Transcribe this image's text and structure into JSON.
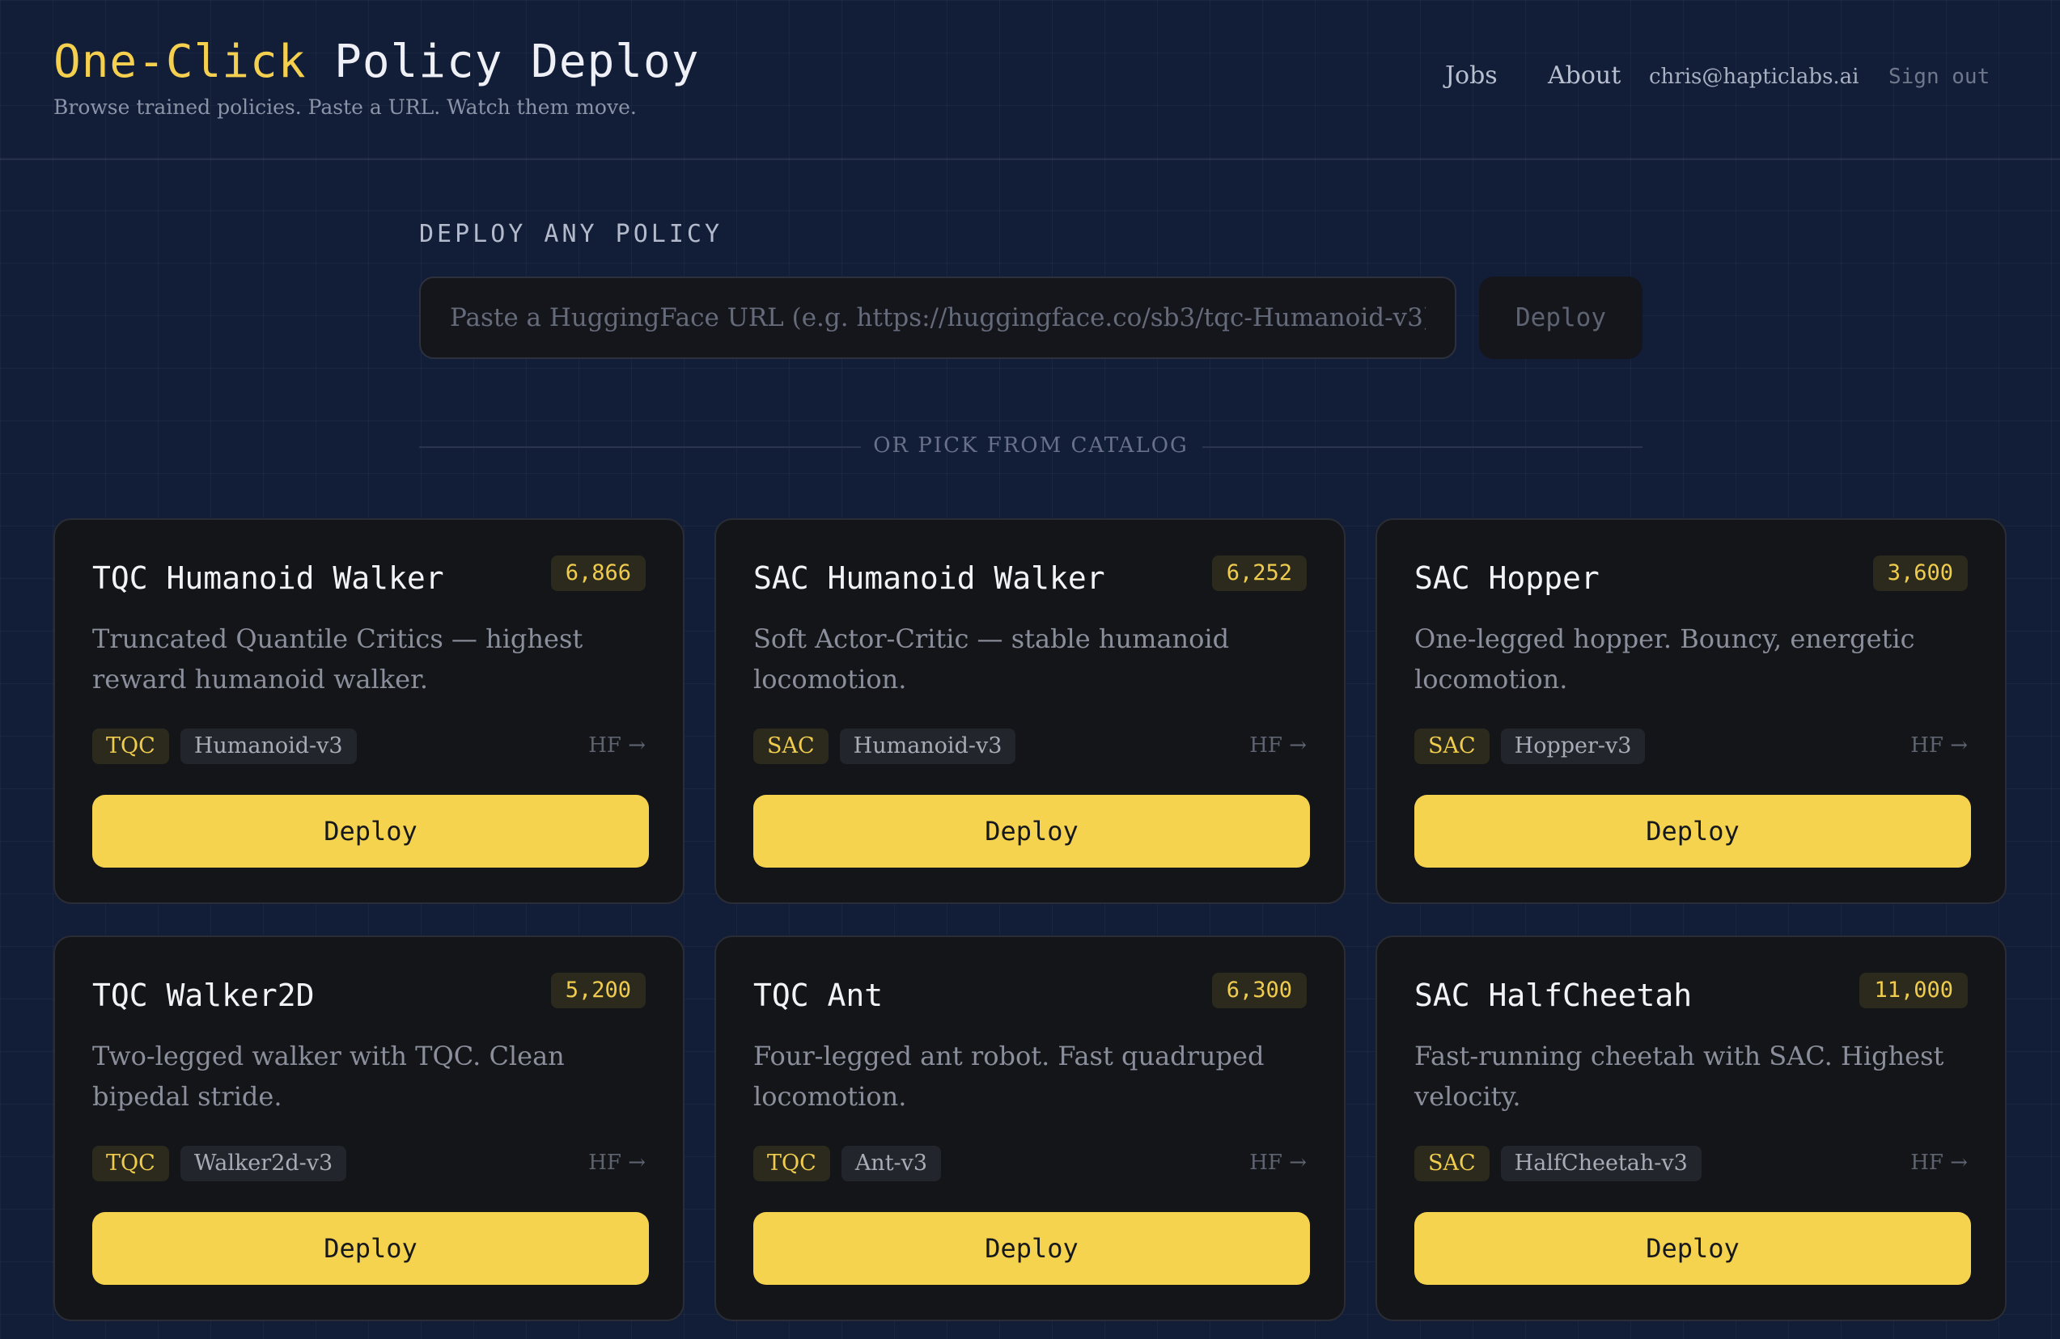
{
  "header": {
    "brand_accent": "One-Click",
    "brand_rest": " Policy Deploy",
    "tagline": "Browse trained policies. Paste a URL. Watch them move.",
    "nav": {
      "jobs": "Jobs",
      "about": "About",
      "email": "chris@hapticlabs.ai",
      "sign_out": "Sign out"
    }
  },
  "deploy_section": {
    "label": "DEPLOY ANY POLICY",
    "input_value": "",
    "input_placeholder": "Paste a HuggingFace URL (e.g. https://huggingface.co/sb3/tqc-Humanoid-v3)",
    "button_label": "Deploy",
    "divider_text": "OR PICK FROM CATALOG"
  },
  "catalog": [
    {
      "title": "TQC Humanoid Walker",
      "score": "6,866",
      "description": "Truncated Quantile Critics — highest reward humanoid walker.",
      "algo": "TQC",
      "env": "Humanoid-v3",
      "hf_link": "HF →",
      "button_label": "Deploy"
    },
    {
      "title": "SAC Humanoid Walker",
      "score": "6,252",
      "description": "Soft Actor-Critic — stable humanoid locomotion.",
      "algo": "SAC",
      "env": "Humanoid-v3",
      "hf_link": "HF →",
      "button_label": "Deploy"
    },
    {
      "title": "SAC Hopper",
      "score": "3,600",
      "description": "One-legged hopper. Bouncy, energetic locomotion.",
      "algo": "SAC",
      "env": "Hopper-v3",
      "hf_link": "HF →",
      "button_label": "Deploy"
    },
    {
      "title": "TQC Walker2D",
      "score": "5,200",
      "description": "Two-legged walker with TQC. Clean bipedal stride.",
      "algo": "TQC",
      "env": "Walker2d-v3",
      "hf_link": "HF →",
      "button_label": "Deploy"
    },
    {
      "title": "TQC Ant",
      "score": "6,300",
      "description": "Four-legged ant robot. Fast quadruped locomotion.",
      "algo": "TQC",
      "env": "Ant-v3",
      "hf_link": "HF →",
      "button_label": "Deploy"
    },
    {
      "title": "SAC HalfCheetah",
      "score": "11,000",
      "description": "Fast-running cheetah with SAC. Highest velocity.",
      "algo": "SAC",
      "env": "HalfCheetah-v3",
      "hf_link": "HF →",
      "button_label": "Deploy"
    }
  ],
  "colors": {
    "background": "#121d38",
    "accent": "#f6d34e",
    "card_background": "#131518"
  }
}
